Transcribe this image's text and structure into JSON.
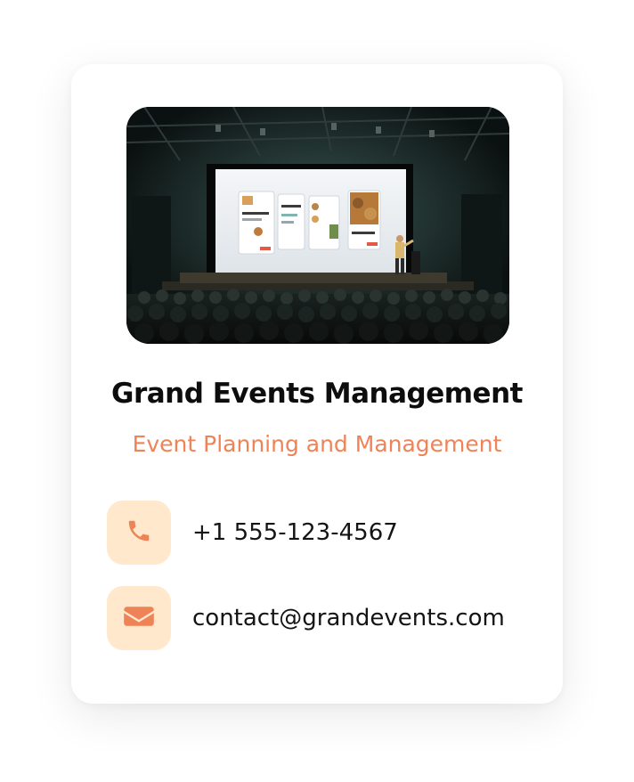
{
  "card": {
    "image_alt": "Presenter on stage in front of a large projection screen facing an audience",
    "company_name": "Grand Events Management",
    "tagline": "Event Planning and Management"
  },
  "contacts": {
    "phone": {
      "icon": "phone-icon",
      "value": "+1 555-123-4567"
    },
    "email": {
      "icon": "envelope-icon",
      "value": "contact@grandevents.com"
    }
  },
  "colors": {
    "accent": "#ef8358",
    "icon_tile_bg": "#ffe8cb",
    "title_text": "#0d0d0d",
    "body_text": "#141414",
    "card_bg": "#ffffff"
  }
}
